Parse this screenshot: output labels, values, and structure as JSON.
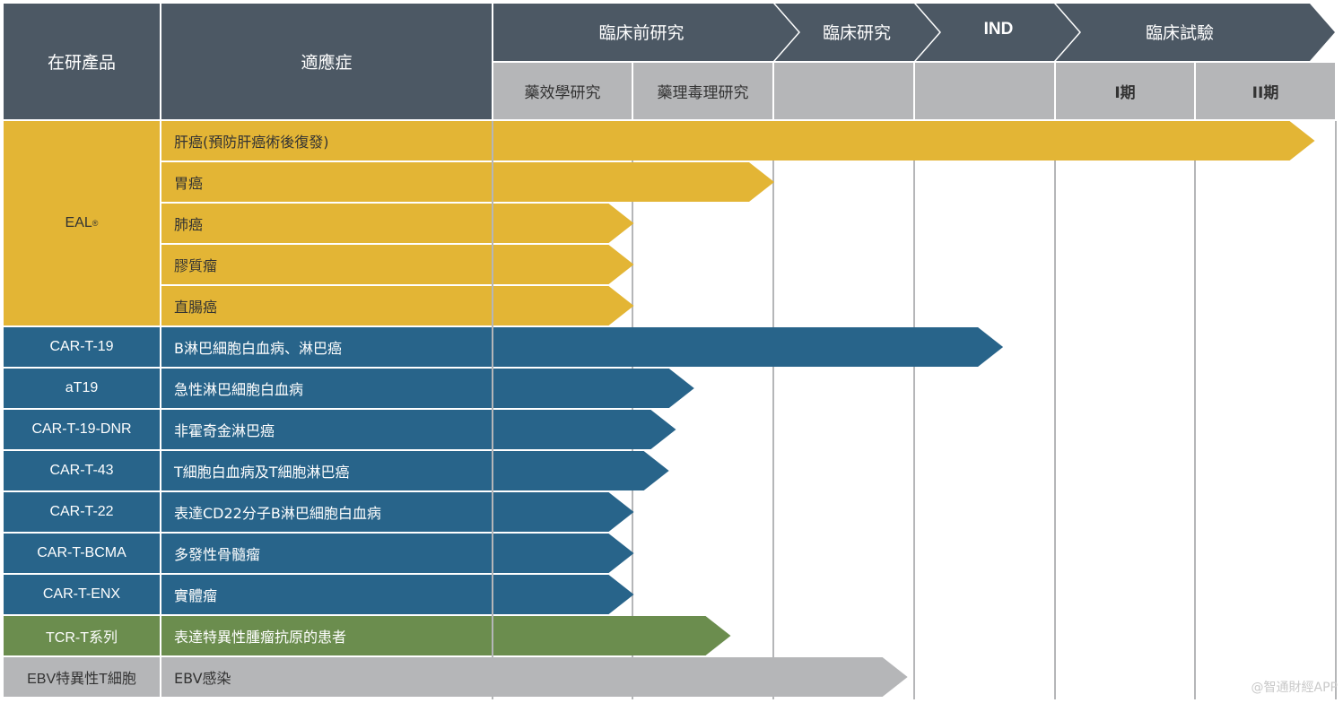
{
  "header": {
    "product_col": "在研產品",
    "indication_col": "適應症",
    "phases": [
      "臨床前研究",
      "臨床研究",
      "IND",
      "臨床試驗"
    ],
    "sub_phases": [
      "藥效學研究",
      "藥理毒理研究",
      "",
      "",
      "I期",
      "II期"
    ]
  },
  "colors": {
    "header": "#4c5864",
    "subheader": "#b5b6b8",
    "eal": "#e3b535",
    "cart": "#28648a",
    "tcr": "#6b8d4e",
    "ebv": "#b5b6b8"
  },
  "rows": [
    {
      "indication": "肝癌(預防肝癌術後復發)",
      "color": "eal",
      "progress_stage": 5.85
    },
    {
      "indication": "胃癌",
      "color": "eal",
      "progress_stage": 2.0
    },
    {
      "indication": "肺癌",
      "color": "eal",
      "progress_stage": 1.0
    },
    {
      "indication": "膠質瘤",
      "color": "eal",
      "progress_stage": 1.0
    },
    {
      "indication": "直腸癌",
      "color": "eal",
      "progress_stage": 1.0
    },
    {
      "indication": "B淋巴細胞白血病、淋巴癌",
      "color": "cart",
      "progress_stage": 3.63
    },
    {
      "indication": "急性淋巴細胞白血病",
      "color": "cart",
      "progress_stage": 1.43
    },
    {
      "indication": "非霍奇金淋巴癌",
      "color": "cart",
      "progress_stage": 1.3
    },
    {
      "indication": "T細胞白血病及T細胞淋巴癌",
      "color": "cart",
      "progress_stage": 1.25
    },
    {
      "indication": "表達CD22分子B淋巴細胞白血病",
      "color": "cart",
      "progress_stage": 1.0
    },
    {
      "indication": "多發性骨髓瘤",
      "color": "cart",
      "progress_stage": 1.0
    },
    {
      "indication": "實體瘤",
      "color": "cart",
      "progress_stage": 1.0
    },
    {
      "indication": "表達特異性腫瘤抗原的患者",
      "color": "tcr",
      "progress_stage": 1.69
    },
    {
      "indication": "EBV感染",
      "color": "ebv",
      "progress_stage": 2.95
    }
  ],
  "products": [
    {
      "name": "EAL",
      "sup": "®",
      "color": "eal"
    },
    {
      "name": "CAR-T-19",
      "sup": "",
      "color": "cart"
    },
    {
      "name": "aT19",
      "sup": "",
      "color": "cart"
    },
    {
      "name": "CAR-T-19-DNR",
      "sup": "",
      "color": "cart"
    },
    {
      "name": "CAR-T-43",
      "sup": "",
      "color": "cart"
    },
    {
      "name": "CAR-T-22",
      "sup": "",
      "color": "cart"
    },
    {
      "name": "CAR-T-BCMA",
      "sup": "",
      "color": "cart"
    },
    {
      "name": "CAR-T-ENX",
      "sup": "",
      "color": "cart"
    },
    {
      "name": "TCR-T系列",
      "sup": "",
      "color": "tcr"
    },
    {
      "name": "EBV特異性T細胞",
      "sup": "",
      "color": "ebv"
    }
  ],
  "watermark": "@智通財經APP"
}
